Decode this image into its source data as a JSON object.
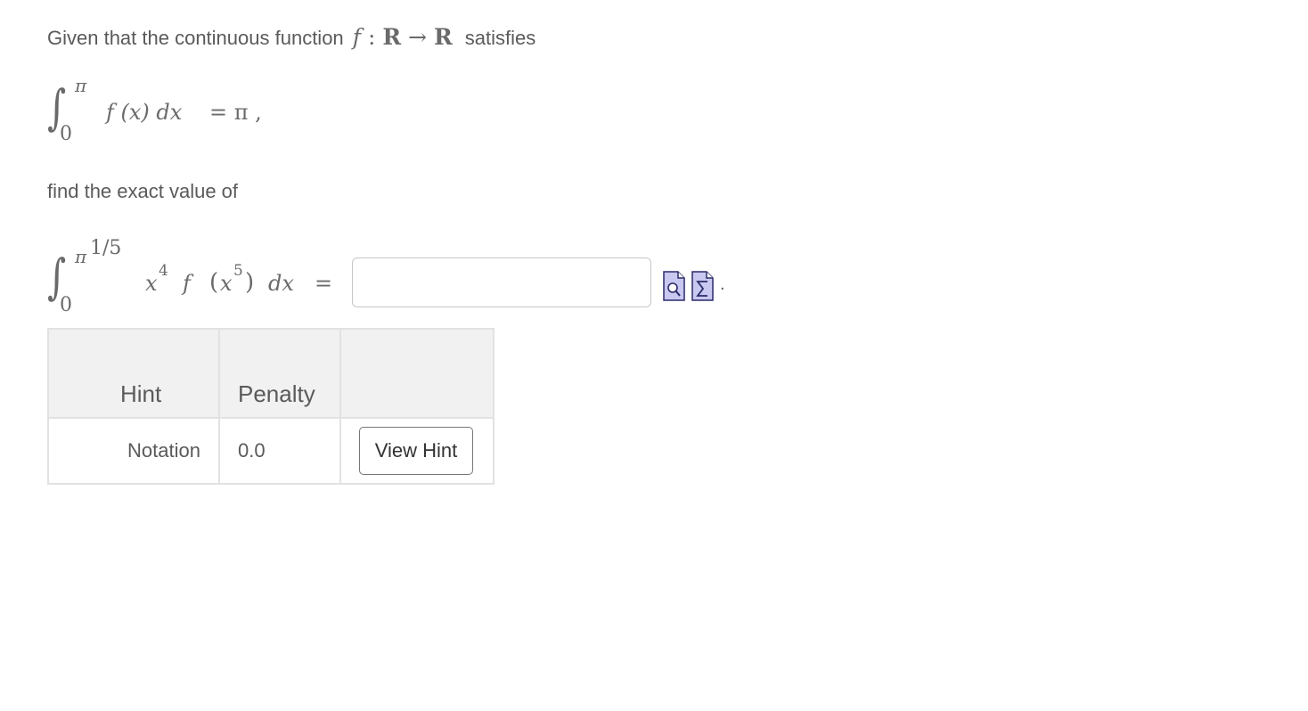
{
  "question": {
    "intro_text": "Given that the continuous function",
    "function_mapping": {
      "f": "f",
      "colon": ":",
      "domain": "R",
      "arrow": "→",
      "codomain": "R"
    },
    "intro_suffix": "satisfies",
    "given_integral": {
      "lower": "0",
      "upper": "π",
      "integrand": "f (x) dx",
      "rhs": "= π ,"
    },
    "find_text": "find the exact value of",
    "target_integral": {
      "lower": "0",
      "upper_base": "π",
      "upper_exp": "1/5",
      "x": "x",
      "x_exp": "4",
      "f": "f",
      "inner_open": "(",
      "inner_x": "x",
      "inner_exp": "5",
      "inner_close": ")",
      "dx": "dx",
      "equals": "="
    },
    "answer_value": "",
    "answer_placeholder": "",
    "trailing_period": "."
  },
  "tools": {
    "preview_icon": "preview-document-magnifier-icon",
    "equation_icon": "equation-editor-sigma-icon",
    "icon_fill": "#c8c8f0",
    "icon_stroke": "#2a2a6a"
  },
  "hint_table": {
    "headers": [
      "Hint",
      "Penalty",
      ""
    ],
    "rows": [
      {
        "hint": "Notation",
        "penalty": "0.0",
        "action_label": "View Hint"
      }
    ]
  }
}
